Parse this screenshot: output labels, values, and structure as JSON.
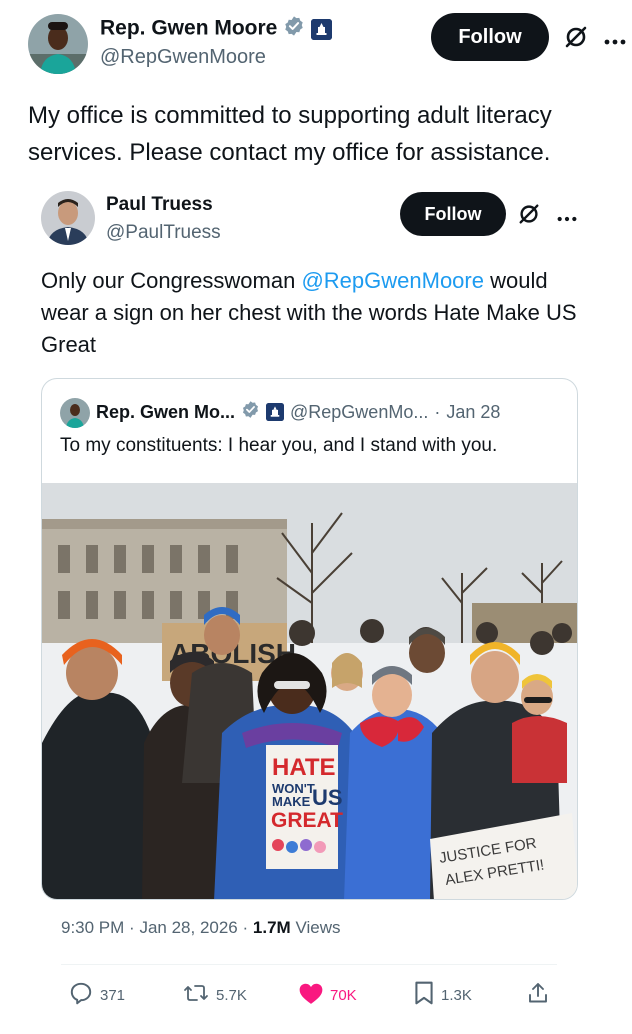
{
  "main_tweet": {
    "author_name": "Rep. Gwen Moore",
    "handle": "@RepGwenMoore",
    "follow_label": "Follow",
    "text": "My office is committed to supporting adult literacy services. Please contact my office for assistance."
  },
  "quoted_tweet": {
    "author_name": "Paul Truess",
    "handle": "@PaulTruess",
    "follow_label": "Follow",
    "text_before": "Only our Congresswoman ",
    "mention": "@RepGwenMoore",
    "text_after": " would wear a sign on her chest with the words Hate Make US Great"
  },
  "nested_quote": {
    "author_name": "Rep. Gwen Mo...",
    "handle": "@RepGwenMo...",
    "separator": "·",
    "date": "Jan 28",
    "text": "To my constituents: I hear you, and I stand with you.",
    "photo": {
      "sign_back": "ABOLISH",
      "sign_hate": "HATE",
      "sign_wont": "WON'T",
      "sign_make": "MAKE",
      "sign_us": "US",
      "sign_great": "GREAT",
      "sign_justice_1": "JUSTICE FOR",
      "sign_justice_2": "ALEX PRETTI!"
    }
  },
  "meta": {
    "time": "9:30 PM",
    "separator": "·",
    "date": "Jan 28, 2026",
    "views_count": "1.7M",
    "views_label": "Views"
  },
  "actions": {
    "replies": "371",
    "reposts": "5.7K",
    "likes": "70K",
    "bookmarks": "1.3K"
  },
  "colors": {
    "accent": "#1d9bf0",
    "like": "#f91880",
    "text": "#0f1419",
    "muted": "#536471",
    "follow_bg": "#0f1419"
  },
  "icons": [
    "verified-badge-icon",
    "government-badge-icon",
    "grok-icon",
    "more-icon",
    "reply-icon",
    "repost-icon",
    "like-icon",
    "bookmark-icon",
    "share-icon"
  ]
}
